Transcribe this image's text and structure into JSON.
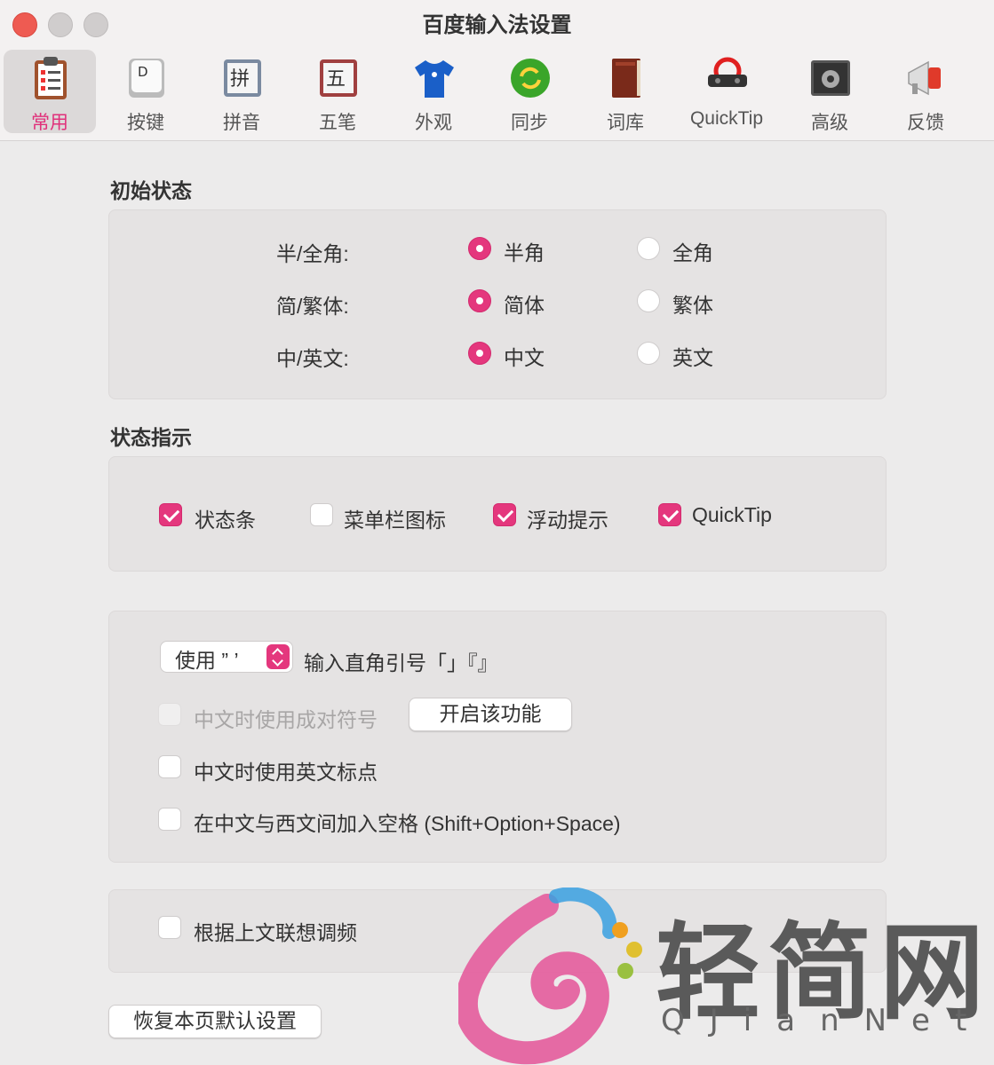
{
  "window": {
    "title": "百度输入法设置"
  },
  "toolbar": {
    "items": [
      {
        "label": "常用",
        "icon": "clipboard-checklist-icon"
      },
      {
        "label": "按键",
        "icon": "keyboard-key-icon"
      },
      {
        "label": "拼音",
        "icon": "pinyin-tile-icon"
      },
      {
        "label": "五笔",
        "icon": "wubi-tile-icon"
      },
      {
        "label": "外观",
        "icon": "tshirt-icon"
      },
      {
        "label": "同步",
        "icon": "sync-icon"
      },
      {
        "label": "词库",
        "icon": "book-icon"
      },
      {
        "label": "QuickTip",
        "icon": "quicktip-icon"
      },
      {
        "label": "高级",
        "icon": "advanced-gear-icon"
      },
      {
        "label": "反馈",
        "icon": "megaphone-icon"
      }
    ],
    "active_index": 0
  },
  "initial_state": {
    "title": "初始状态",
    "rows": [
      {
        "label": "半/全角:",
        "options": [
          "半角",
          "全角"
        ],
        "selected": 0
      },
      {
        "label": "简/繁体:",
        "options": [
          "简体",
          "繁体"
        ],
        "selected": 0
      },
      {
        "label": "中/英文:",
        "options": [
          "中文",
          "英文"
        ],
        "selected": 0
      }
    ]
  },
  "status_indicator": {
    "title": "状态指示",
    "items": [
      {
        "label": "状态条",
        "checked": true
      },
      {
        "label": "菜单栏图标",
        "checked": false
      },
      {
        "label": "浮动提示",
        "checked": true
      },
      {
        "label": "QuickTip",
        "checked": true
      }
    ]
  },
  "punctuation": {
    "select_value": "使用 ” ’",
    "select_suffix": "输入直角引号「」『』",
    "pair_symbols": {
      "label": "中文时使用成对符号",
      "checked": false,
      "disabled": true
    },
    "enable_button": "开启该功能",
    "english_punct": {
      "label": "中文时使用英文标点",
      "checked": false
    },
    "add_space": {
      "label": "在中文与西文间加入空格 (Shift+Option+Space)",
      "checked": false
    }
  },
  "association": {
    "label": "根据上文联想调频",
    "checked": false
  },
  "restore_button": "恢复本页默认设置",
  "watermark": {
    "text": "轻简网",
    "sub": "QJianNet"
  },
  "colors": {
    "accent": "#e4377d",
    "close": "#ee5b52"
  }
}
